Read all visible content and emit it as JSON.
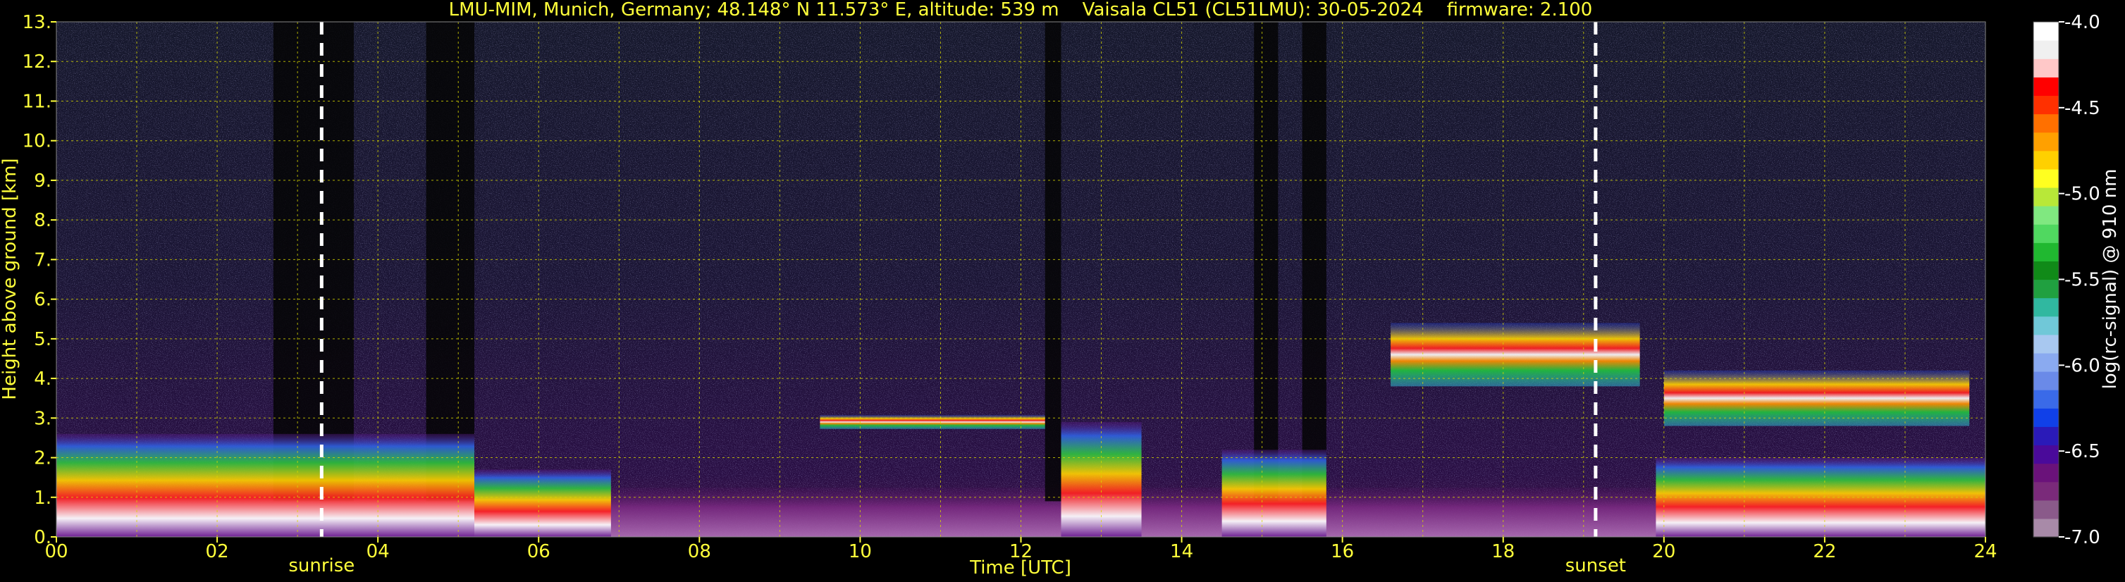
{
  "chart_data": {
    "type": "heatmap",
    "title": "LMU-MIM, Munich, Germany; 48.148° N 11.573° E, altitude: 539 m    Vaisala CL51 (CL51LMU): 30-05-2024    firmware: 2.100",
    "xlabel": "Time [UTC]",
    "ylabel": "Height above ground [km]",
    "xlim": [
      0,
      24
    ],
    "ylim": [
      0,
      13
    ],
    "x_ticks": [
      "00",
      "02",
      "04",
      "06",
      "08",
      "10",
      "12",
      "14",
      "16",
      "18",
      "20",
      "22",
      "24"
    ],
    "x_tick_values": [
      0,
      2,
      4,
      6,
      8,
      10,
      12,
      14,
      16,
      18,
      20,
      22,
      24
    ],
    "y_ticks": [
      "0.",
      "1.",
      "2.",
      "3.",
      "4.",
      "5.",
      "6.",
      "7.",
      "8.",
      "9.",
      "10.",
      "11.",
      "12.",
      "13."
    ],
    "y_tick_values": [
      0,
      1,
      2,
      3,
      4,
      5,
      6,
      7,
      8,
      9,
      10,
      11,
      12,
      13
    ],
    "grid": true,
    "annotations": [
      {
        "text": "sunrise",
        "x": 3.3
      },
      {
        "text": "sunset",
        "x": 19.15
      }
    ],
    "colorbar": {
      "label": "log(rc-signal) @ 910 nm",
      "ticks": [
        "-4.0",
        "-4.5",
        "-5.0",
        "-5.5",
        "-6.0",
        "-6.5",
        "-7.0"
      ],
      "tick_values": [
        -4.0,
        -4.5,
        -5.0,
        -5.5,
        -6.0,
        -6.5,
        -7.0
      ],
      "range": [
        -7.0,
        -4.0
      ],
      "colors": [
        "#a88aa8",
        "#8a5a8a",
        "#7a2a7a",
        "#6a127a",
        "#4a0a9a",
        "#2a1ab8",
        "#1040e8",
        "#3a6ae8",
        "#6a8ae8",
        "#8aaaf0",
        "#a8c8f0",
        "#70c8d8",
        "#30b8a0",
        "#20a040",
        "#108a18",
        "#20b830",
        "#50d860",
        "#80e880",
        "#b8e838",
        "#ffff20",
        "#ffd000",
        "#ffa000",
        "#ff7000",
        "#ff3000",
        "#ff0000",
        "#ffc8c8",
        "#f0f0f0",
        "#ffffff"
      ]
    },
    "features": {
      "boundary_layer": [
        {
          "x0": 0.0,
          "x1": 5.2,
          "top": 2.6
        },
        {
          "x0": 5.2,
          "x1": 6.9,
          "top": 1.7
        },
        {
          "x0": 12.5,
          "x1": 13.5,
          "top": 2.9
        },
        {
          "x0": 14.5,
          "x1": 15.8,
          "top": 2.2
        },
        {
          "x0": 19.9,
          "x1": 24.0,
          "top": 2.0
        }
      ],
      "cloud_layers": [
        {
          "x0": 9.5,
          "x1": 12.3,
          "height": 2.9
        },
        {
          "x0": 16.6,
          "x1": 19.7,
          "height": 4.6
        },
        {
          "x0": 20.0,
          "x1": 23.8,
          "height": 3.5
        }
      ],
      "dark_bands": [
        [
          2.7,
          3.7
        ],
        [
          4.6,
          5.2
        ],
        [
          12.3,
          12.5
        ],
        [
          14.9,
          15.2
        ],
        [
          15.5,
          15.8
        ]
      ]
    }
  }
}
